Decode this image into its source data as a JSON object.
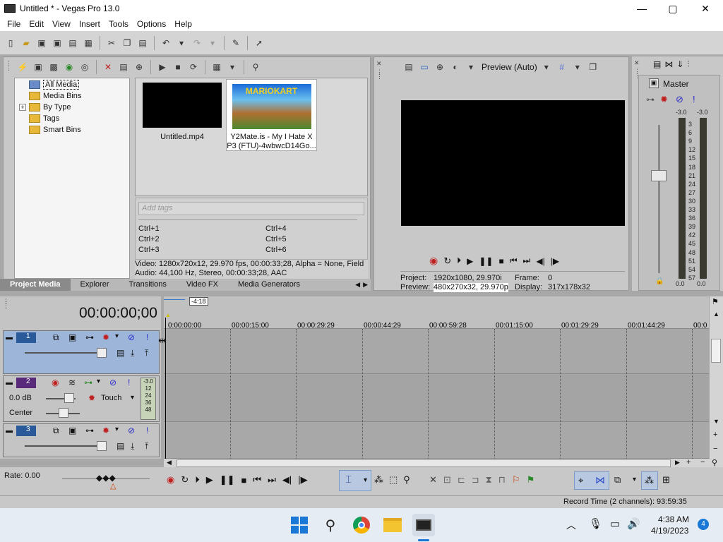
{
  "window": {
    "title": "Untitled * - Vegas Pro 13.0",
    "minimize": "—",
    "maximize": "▢",
    "close": "✕"
  },
  "menu": [
    "File",
    "Edit",
    "View",
    "Insert",
    "Tools",
    "Options",
    "Help"
  ],
  "media_tree": {
    "items": [
      {
        "label": "All Media",
        "selected": true
      },
      {
        "label": "Media Bins"
      },
      {
        "label": "By Type",
        "expander": "+"
      },
      {
        "label": "Tags"
      },
      {
        "label": "Smart Bins"
      }
    ]
  },
  "media_files": [
    {
      "name": "Untitled.mp4"
    },
    {
      "name_line1": "Y2Mate.is - My I Hate X",
      "name_line2": "P3 (FTU)-4wbwcD14Go...",
      "thumb_text": "MARIOKART"
    }
  ],
  "tags": {
    "placeholder": "Add tags",
    "shortcuts": [
      "Ctrl+1",
      "Ctrl+2",
      "Ctrl+3",
      "Ctrl+4",
      "Ctrl+5",
      "Ctrl+6"
    ]
  },
  "media_info": {
    "video": "Video: 1280x720x12, 29.970 fps, 00:00:33;28, Alpha = None, Field",
    "audio": "Audio: 44,100 Hz, Stereo, 00:00:33;28, AAC"
  },
  "tabs": [
    {
      "label": "Project Media",
      "active": true
    },
    {
      "label": "Explorer"
    },
    {
      "label": "Transitions"
    },
    {
      "label": "Video FX"
    },
    {
      "label": "Media Generators"
    }
  ],
  "preview": {
    "mode": "Preview (Auto)",
    "project_label": "Project:",
    "project_value": "1920x1080, 29.970i",
    "preview_label": "Preview:",
    "preview_value": "480x270x32, 29.970p",
    "frame_label": "Frame:",
    "frame_value": "0",
    "display_label": "Display:",
    "display_value": "317x178x32"
  },
  "master": {
    "title": "Master",
    "peak_left": "-3.0",
    "peak_right": "-3.0",
    "scale": [
      "3",
      "6",
      "9",
      "12",
      "15",
      "18",
      "21",
      "24",
      "27",
      "30",
      "33",
      "36",
      "39",
      "42",
      "45",
      "48",
      "51",
      "54",
      "57"
    ],
    "bottom_left": "0.0",
    "bottom_right": "0.0"
  },
  "timeline": {
    "timecode": "00:00:00;00",
    "marker": "-4:18",
    "ruler": [
      "0:00:00:00",
      "00:00:15:00",
      "00:00:29:29",
      "00:00:44:29",
      "00:00:59:28",
      "00:01:15:00",
      "00:01:29:29",
      "00:01:44:29",
      "00:0"
    ],
    "tracks": [
      {
        "num": "1",
        "type": "video"
      },
      {
        "num": "2",
        "type": "audio",
        "volume": "0.0 dB",
        "pan": "Center",
        "mode": "Touch",
        "meter_top": "-3.0",
        "meter_scale": [
          "12",
          "24",
          "36",
          "48"
        ]
      },
      {
        "num": "3",
        "type": "video"
      }
    ]
  },
  "rate": "Rate: 0.00",
  "status": "Record Time (2 channels): 93:59:35",
  "taskbar": {
    "time": "4:38 AM",
    "date": "4/19/2023",
    "notifications": "4"
  },
  "colors": {
    "accent": "#3a7ac8",
    "video_track": "#9db5d8",
    "audio_track": "#c4c4c4",
    "record": "#d03030"
  }
}
